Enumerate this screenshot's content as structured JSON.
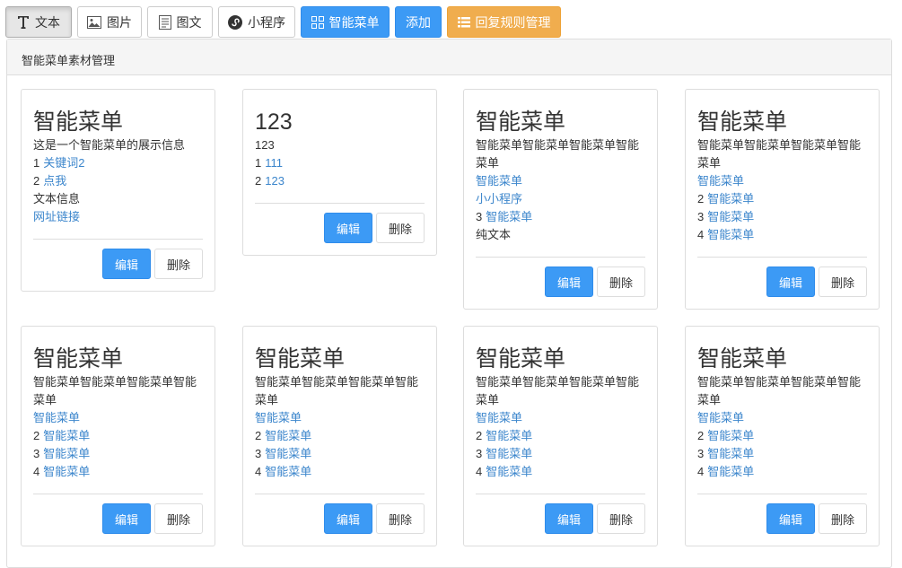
{
  "toolbar": {
    "text": "文本",
    "image": "图片",
    "news": "图文",
    "miniapp": "小程序",
    "smartmenu": "智能菜单",
    "add": "添加",
    "rules": "回复规则管理"
  },
  "panel": {
    "heading": "智能菜单素材管理"
  },
  "actions": {
    "edit": "编辑",
    "delete": "删除"
  },
  "cards": [
    {
      "title": "智能菜单",
      "lines": [
        {
          "num": "",
          "text": "这是一个智能菜单的展示信息",
          "link": false
        },
        {
          "num": "1",
          "text": "关键词2",
          "link": true
        },
        {
          "num": "2",
          "text": "点我",
          "link": true
        },
        {
          "num": "",
          "text": "文本信息",
          "link": false
        },
        {
          "num": "",
          "text": "网址链接",
          "link": true
        }
      ]
    },
    {
      "title": "123",
      "lines": [
        {
          "num": "",
          "text": "123",
          "link": false
        },
        {
          "num": "1",
          "text": "111",
          "link": true
        },
        {
          "num": "2",
          "text": "123",
          "link": true
        }
      ]
    },
    {
      "title": "智能菜单",
      "lines": [
        {
          "num": "",
          "text": "智能菜单智能菜单智能菜单智能菜单",
          "link": false
        },
        {
          "num": "",
          "text": "智能菜单",
          "link": true
        },
        {
          "num": "",
          "text": "小小程序",
          "link": true
        },
        {
          "num": "3",
          "text": "智能菜单",
          "link": true
        },
        {
          "num": "",
          "text": "纯文本",
          "link": false
        }
      ]
    },
    {
      "title": "智能菜单",
      "lines": [
        {
          "num": "",
          "text": "智能菜单智能菜单智能菜单智能菜单",
          "link": false
        },
        {
          "num": "",
          "text": "智能菜单",
          "link": true
        },
        {
          "num": "2",
          "text": "智能菜单",
          "link": true
        },
        {
          "num": "3",
          "text": "智能菜单",
          "link": true
        },
        {
          "num": "4",
          "text": "智能菜单",
          "link": true
        }
      ]
    },
    {
      "title": "智能菜单",
      "lines": [
        {
          "num": "",
          "text": "智能菜单智能菜单智能菜单智能菜单",
          "link": false
        },
        {
          "num": "",
          "text": "智能菜单",
          "link": true
        },
        {
          "num": "2",
          "text": "智能菜单",
          "link": true
        },
        {
          "num": "3",
          "text": "智能菜单",
          "link": true
        },
        {
          "num": "4",
          "text": "智能菜单",
          "link": true
        }
      ]
    },
    {
      "title": "智能菜单",
      "lines": [
        {
          "num": "",
          "text": "智能菜单智能菜单智能菜单智能菜单",
          "link": false
        },
        {
          "num": "",
          "text": "智能菜单",
          "link": true
        },
        {
          "num": "2",
          "text": "智能菜单",
          "link": true
        },
        {
          "num": "3",
          "text": "智能菜单",
          "link": true
        },
        {
          "num": "4",
          "text": "智能菜单",
          "link": true
        }
      ]
    },
    {
      "title": "智能菜单",
      "lines": [
        {
          "num": "",
          "text": "智能菜单智能菜单智能菜单智能菜单",
          "link": false
        },
        {
          "num": "",
          "text": "智能菜单",
          "link": true
        },
        {
          "num": "2",
          "text": "智能菜单",
          "link": true
        },
        {
          "num": "3",
          "text": "智能菜单",
          "link": true
        },
        {
          "num": "4",
          "text": "智能菜单",
          "link": true
        }
      ]
    },
    {
      "title": "智能菜单",
      "lines": [
        {
          "num": "",
          "text": "智能菜单智能菜单智能菜单智能菜单",
          "link": false
        },
        {
          "num": "",
          "text": "智能菜单",
          "link": true
        },
        {
          "num": "2",
          "text": "智能菜单",
          "link": true
        },
        {
          "num": "3",
          "text": "智能菜单",
          "link": true
        },
        {
          "num": "4",
          "text": "智能菜单",
          "link": true
        }
      ]
    }
  ]
}
